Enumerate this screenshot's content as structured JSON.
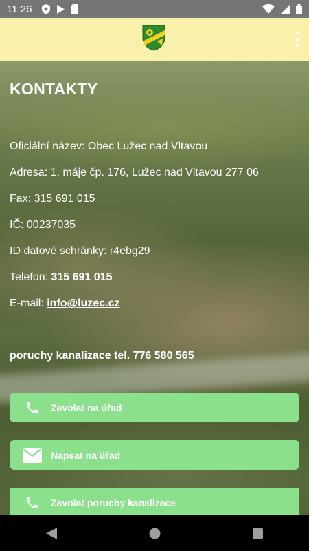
{
  "status_bar": {
    "time": "11:26",
    "icons": [
      "shield-icon",
      "play-icon",
      "sd-card-icon",
      "wifi-icon",
      "signal-icon",
      "battery-icon"
    ]
  },
  "app_bar": {
    "background": "#f9f0ab",
    "crest": "municipal-crest-icon",
    "menu": "overflow-menu-icon"
  },
  "page": {
    "title": "KONTAKTY",
    "official_name": "Oficiální název: Obec Lužec nad Vltavou",
    "address": "Adresa: 1. máje čp. 176, Lužec nad Vltavou 277 06",
    "fax": "Fax: 315 691 015",
    "ic": "IČ: 00237035",
    "databox": "ID datové schránky: r4ebg29",
    "phone_label": "Telefon: ",
    "phone_value": "315 691 015",
    "email_label": "E-mail: ",
    "email_value": "info@luzec.cz",
    "sewer_notice": "poruchy kanalizace tel. 776 580 565"
  },
  "buttons": {
    "call_office": "Zavolat na úřad",
    "write_office": "Napsat na úřad",
    "call_sewer": "Zavolat poruchy kanalizace"
  },
  "colors": {
    "button_green": "#8be08b",
    "status_bar": "#757575",
    "nav_bar": "#000000"
  }
}
